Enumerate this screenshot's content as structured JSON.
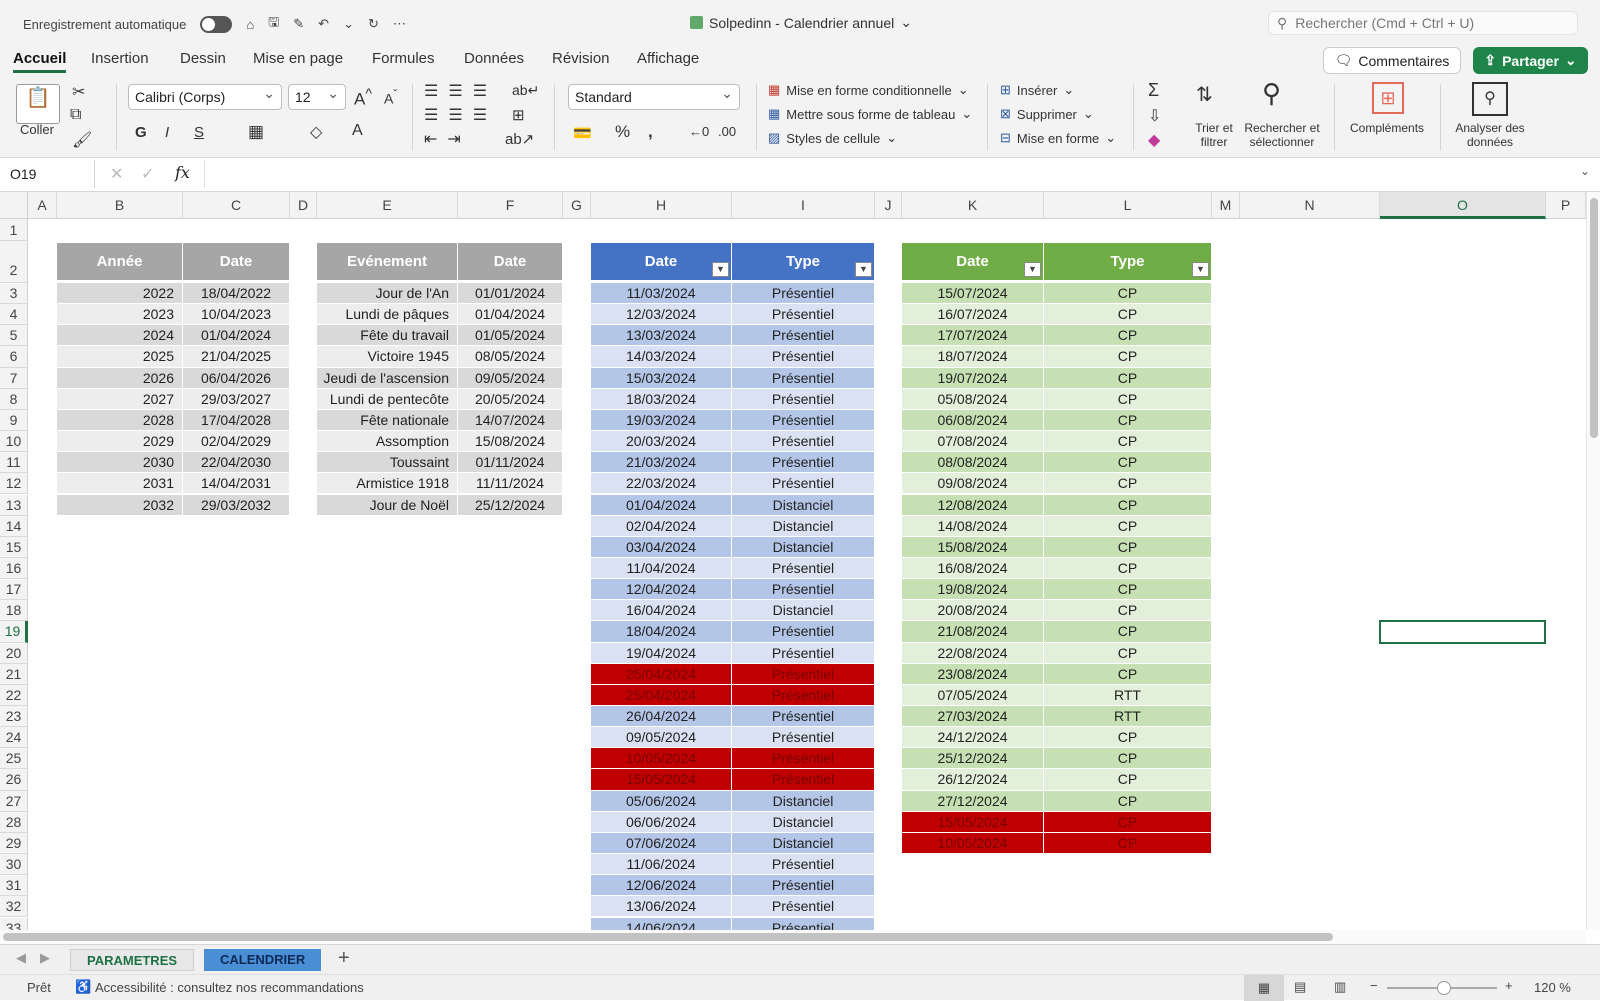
{
  "titlebar": {
    "autosave": "Enregistrement automatique",
    "title": "Solpedinn - Calendrier annuel",
    "search_placeholder": "Rechercher (Cmd + Ctrl + U)"
  },
  "tabs": [
    "Accueil",
    "Insertion",
    "Dessin",
    "Mise en page",
    "Formules",
    "Données",
    "Révision",
    "Affichage"
  ],
  "actions": {
    "comments": "Commentaires",
    "share": "Partager"
  },
  "ribbon": {
    "paste": "Coller",
    "font": "Calibri (Corps)",
    "size": "12",
    "bold": "G",
    "italic": "I",
    "underline": "S",
    "number_format": "Standard",
    "cond_format": "Mise en forme conditionnelle",
    "as_table": "Mettre sous forme de tableau",
    "cell_styles": "Styles de cellule",
    "insert": "Insérer",
    "delete": "Supprimer",
    "format": "Mise en forme",
    "sort_filter": "Trier et filtrer",
    "find_select": "Rechercher et sélectionner",
    "addins": "Compléments",
    "analyze": "Analyser des données"
  },
  "formula_bar": {
    "name_box": "O19",
    "fx": "fx"
  },
  "columns": [
    "A",
    "B",
    "C",
    "D",
    "E",
    "F",
    "G",
    "H",
    "I",
    "J",
    "K",
    "L",
    "M",
    "N",
    "O",
    "P"
  ],
  "selected_column": "O",
  "selected_row": "19",
  "rows": [
    "1",
    "2",
    "3",
    "4",
    "5",
    "6",
    "7",
    "8",
    "9",
    "10",
    "11",
    "12",
    "13",
    "14",
    "15",
    "16",
    "17",
    "18",
    "19",
    "20",
    "21",
    "22",
    "23",
    "24",
    "25",
    "26",
    "27",
    "28",
    "29",
    "30",
    "31",
    "32",
    "33"
  ],
  "table_easter": {
    "headers": [
      "Année",
      "Date"
    ],
    "rows": [
      [
        "2022",
        "18/04/2022"
      ],
      [
        "2023",
        "10/04/2023"
      ],
      [
        "2024",
        "01/04/2024"
      ],
      [
        "2025",
        "21/04/2025"
      ],
      [
        "2026",
        "06/04/2026"
      ],
      [
        "2027",
        "29/03/2027"
      ],
      [
        "2028",
        "17/04/2028"
      ],
      [
        "2029",
        "02/04/2029"
      ],
      [
        "2030",
        "22/04/2030"
      ],
      [
        "2031",
        "14/04/2031"
      ],
      [
        "2032",
        "29/03/2032"
      ]
    ]
  },
  "table_holidays": {
    "headers": [
      "Evénement",
      "Date"
    ],
    "rows": [
      [
        "Jour de l'An",
        "01/01/2024"
      ],
      [
        "Lundi de pâques",
        "01/04/2024"
      ],
      [
        "Fête du travail",
        "01/05/2024"
      ],
      [
        "Victoire 1945",
        "08/05/2024"
      ],
      [
        "Jeudi de l'ascension",
        "09/05/2024"
      ],
      [
        "Lundi de pentecôte",
        "20/05/2024"
      ],
      [
        "Fête nationale",
        "14/07/2024"
      ],
      [
        "Assomption",
        "15/08/2024"
      ],
      [
        "Toussaint",
        "01/11/2024"
      ],
      [
        "Armistice 1918",
        "11/11/2024"
      ],
      [
        "Jour de Noël",
        "25/12/2024"
      ]
    ]
  },
  "table_work": {
    "headers": [
      "Date",
      "Type"
    ],
    "rows": [
      [
        "11/03/2024",
        "Présentiel",
        false
      ],
      [
        "12/03/2024",
        "Présentiel",
        false
      ],
      [
        "13/03/2024",
        "Présentiel",
        false
      ],
      [
        "14/03/2024",
        "Présentiel",
        false
      ],
      [
        "15/03/2024",
        "Présentiel",
        false
      ],
      [
        "18/03/2024",
        "Présentiel",
        false
      ],
      [
        "19/03/2024",
        "Présentiel",
        false
      ],
      [
        "20/03/2024",
        "Présentiel",
        false
      ],
      [
        "21/03/2024",
        "Présentiel",
        false
      ],
      [
        "22/03/2024",
        "Présentiel",
        false
      ],
      [
        "01/04/2024",
        "Distanciel",
        false
      ],
      [
        "02/04/2024",
        "Distanciel",
        false
      ],
      [
        "03/04/2024",
        "Distanciel",
        false
      ],
      [
        "11/04/2024",
        "Présentiel",
        false
      ],
      [
        "12/04/2024",
        "Présentiel",
        false
      ],
      [
        "16/04/2024",
        "Distanciel",
        false
      ],
      [
        "18/04/2024",
        "Présentiel",
        false
      ],
      [
        "19/04/2024",
        "Présentiel",
        false
      ],
      [
        "25/04/2024",
        "Présentiel",
        true
      ],
      [
        "25/04/2024",
        "Présentiel",
        true
      ],
      [
        "26/04/2024",
        "Présentiel",
        false
      ],
      [
        "09/05/2024",
        "Présentiel",
        false
      ],
      [
        "10/05/2024",
        "Présentiel",
        true
      ],
      [
        "15/05/2024",
        "Présentiel",
        true
      ],
      [
        "05/06/2024",
        "Distanciel",
        false
      ],
      [
        "06/06/2024",
        "Distanciel",
        false
      ],
      [
        "07/06/2024",
        "Distanciel",
        false
      ],
      [
        "11/06/2024",
        "Présentiel",
        false
      ],
      [
        "12/06/2024",
        "Présentiel",
        false
      ],
      [
        "13/06/2024",
        "Présentiel",
        false
      ],
      [
        "14/06/2024",
        "Présentiel",
        false
      ]
    ]
  },
  "table_leave": {
    "headers": [
      "Date",
      "Type"
    ],
    "rows": [
      [
        "15/07/2024",
        "CP",
        false
      ],
      [
        "16/07/2024",
        "CP",
        false
      ],
      [
        "17/07/2024",
        "CP",
        false
      ],
      [
        "18/07/2024",
        "CP",
        false
      ],
      [
        "19/07/2024",
        "CP",
        false
      ],
      [
        "05/08/2024",
        "CP",
        false
      ],
      [
        "06/08/2024",
        "CP",
        false
      ],
      [
        "07/08/2024",
        "CP",
        false
      ],
      [
        "08/08/2024",
        "CP",
        false
      ],
      [
        "09/08/2024",
        "CP",
        false
      ],
      [
        "12/08/2024",
        "CP",
        false
      ],
      [
        "14/08/2024",
        "CP",
        false
      ],
      [
        "15/08/2024",
        "CP",
        false
      ],
      [
        "16/08/2024",
        "CP",
        false
      ],
      [
        "19/08/2024",
        "CP",
        false
      ],
      [
        "20/08/2024",
        "CP",
        false
      ],
      [
        "21/08/2024",
        "CP",
        false
      ],
      [
        "22/08/2024",
        "CP",
        false
      ],
      [
        "23/08/2024",
        "CP",
        false
      ],
      [
        "07/05/2024",
        "RTT",
        false
      ],
      [
        "27/03/2024",
        "RTT",
        false
      ],
      [
        "24/12/2024",
        "CP",
        false
      ],
      [
        "25/12/2024",
        "CP",
        false
      ],
      [
        "26/12/2024",
        "CP",
        false
      ],
      [
        "27/12/2024",
        "CP",
        false
      ],
      [
        "15/05/2024",
        "CP",
        true
      ],
      [
        "10/05/2024",
        "CP",
        true
      ]
    ]
  },
  "sheets": [
    "PARAMETRES",
    "CALENDRIER"
  ],
  "active_sheet": "CALENDRIER",
  "status": {
    "ready": "Prêt",
    "accessibility": "Accessibilité : consultez nos recommandations",
    "zoom": "120 %"
  },
  "colors": {
    "accent": "#1e7145",
    "blue_header": "#4472c4",
    "blue_dark": "#b4c6e7",
    "blue_light": "#d9e1f2",
    "green_header": "#70ad47",
    "green_dark": "#c6e0b4",
    "green_light": "#e2efda",
    "gray_header": "#a6a6a6",
    "gray_dark": "#d9d9d9",
    "gray_light": "#ededed",
    "alert": "#c00000"
  }
}
